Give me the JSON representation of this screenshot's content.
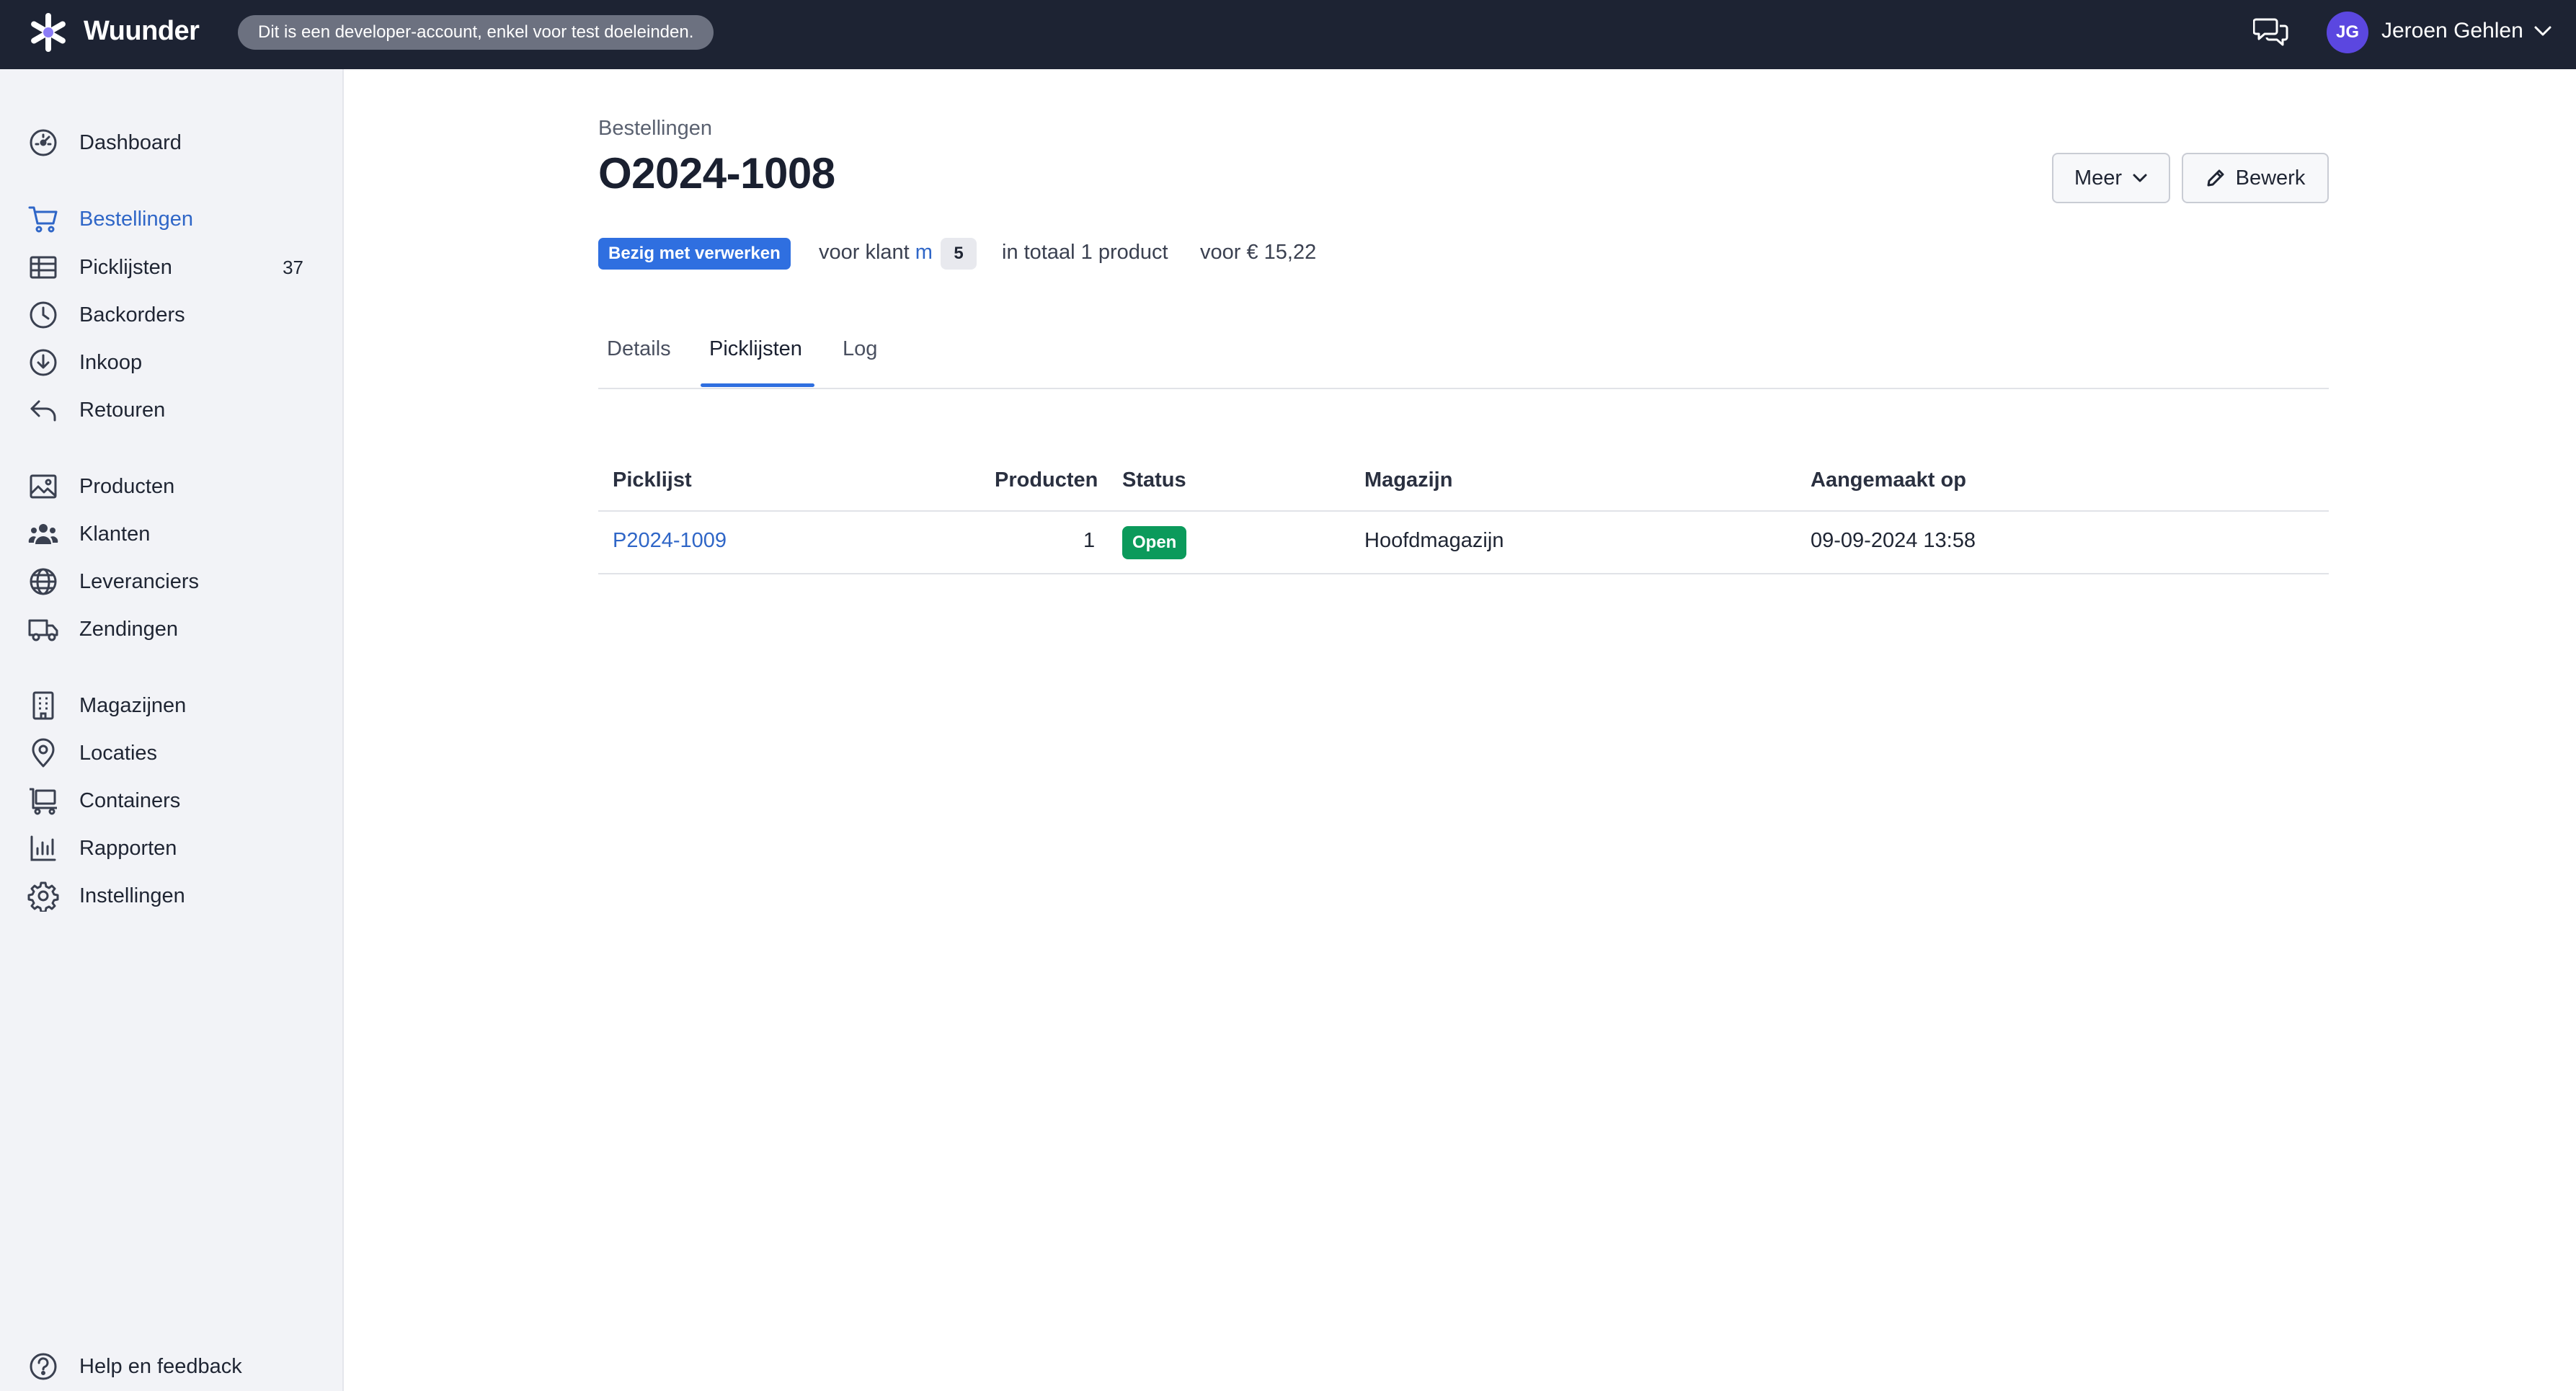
{
  "topbar": {
    "brand": "Wuunder",
    "dev_notice": "Dit is een developer-account, enkel voor test doeleinden.",
    "user_initials": "JG",
    "user_name": "Jeroen Gehlen"
  },
  "sidebar": {
    "items": [
      {
        "label": "Dashboard",
        "icon": "dashboard-icon"
      },
      {
        "label": "Bestellingen",
        "icon": "cart-icon",
        "active": true
      },
      {
        "label": "Picklijsten",
        "icon": "table-icon",
        "count": "37"
      },
      {
        "label": "Backorders",
        "icon": "clock-icon"
      },
      {
        "label": "Inkoop",
        "icon": "download-circle-icon"
      },
      {
        "label": "Retouren",
        "icon": "return-arrow-icon"
      },
      {
        "label": "Producten",
        "icon": "image-icon"
      },
      {
        "label": "Klanten",
        "icon": "users-icon"
      },
      {
        "label": "Leveranciers",
        "icon": "globe-icon"
      },
      {
        "label": "Zendingen",
        "icon": "truck-icon"
      },
      {
        "label": "Magazijnen",
        "icon": "building-icon"
      },
      {
        "label": "Locaties",
        "icon": "map-pin-icon"
      },
      {
        "label": "Containers",
        "icon": "container-icon"
      },
      {
        "label": "Rapporten",
        "icon": "bar-chart-icon"
      },
      {
        "label": "Instellingen",
        "icon": "gear-icon"
      }
    ],
    "help": "Help en feedback"
  },
  "page": {
    "breadcrumb": "Bestellingen",
    "title": "O2024-1008",
    "more_button": "Meer",
    "edit_button": "Bewerk",
    "status": "Bezig met verwerken",
    "customer_prefix": "voor klant",
    "customer_name": "m",
    "customer_count": "5",
    "products_total": "in totaal 1 product",
    "price_total": "voor € 15,22"
  },
  "tabs": [
    "Details",
    "Picklijsten",
    "Log"
  ],
  "table": {
    "headers": [
      "Picklijst",
      "Producten",
      "Status",
      "Magazijn",
      "Aangemaakt op"
    ],
    "rows": [
      [
        "P2024-1009",
        "1",
        "Open",
        "Hoofdmagazijn",
        "09-09-2024 13:58"
      ]
    ]
  },
  "colors": {
    "topbar": "#1d2333",
    "accent": "#2f6fe0",
    "link": "#2f66c7",
    "status_open": "#0b9a5b",
    "avatar": "#5b47e0"
  }
}
